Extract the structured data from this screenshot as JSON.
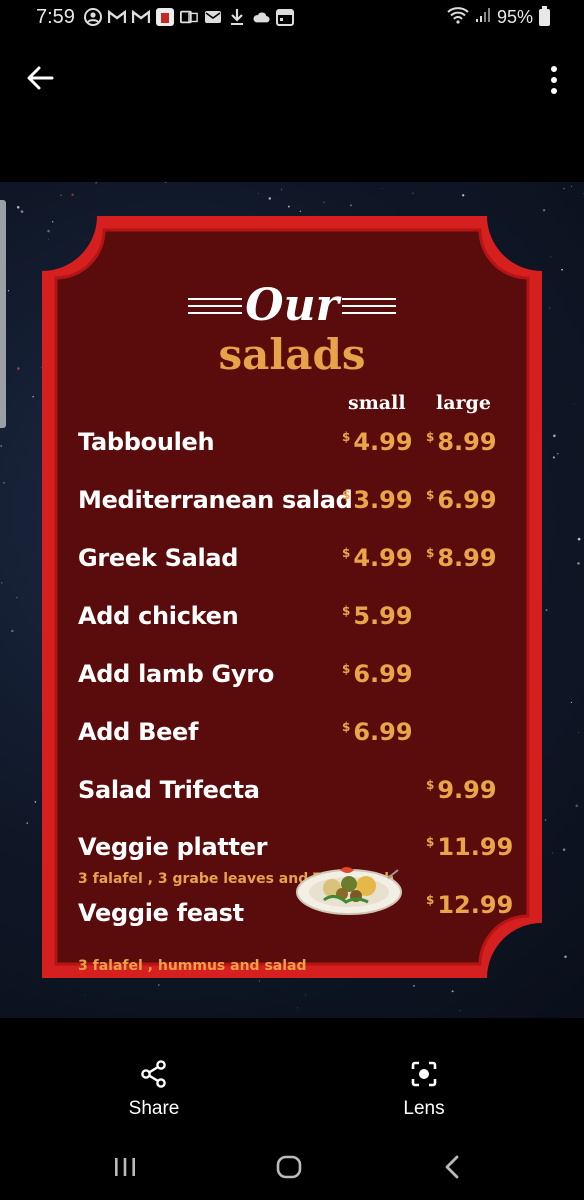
{
  "status_bar": {
    "time": "7:59",
    "battery": "95%",
    "icons": [
      "account-icon",
      "gmail-icon",
      "gmail-icon",
      "app-icon",
      "outlook-icon",
      "email-icon",
      "download-icon",
      "cloud-icon",
      "calendar-icon",
      "wifi-icon",
      "signal-icon",
      "battery-icon"
    ]
  },
  "menu": {
    "title_top": "Our",
    "title_bottom": "salads",
    "col_small": "small",
    "col_large": "large",
    "currency": "$",
    "items": [
      {
        "name": "Tabbouleh",
        "small": "4.99",
        "large": "8.99"
      },
      {
        "name": "Mediterranean salad",
        "small": "3.99",
        "large": "6.99"
      },
      {
        "name": "Greek Salad",
        "small": "4.99",
        "large": "8.99"
      },
      {
        "name": "Add chicken",
        "small": "5.99"
      },
      {
        "name": "Add lamb Gyro",
        "small": "6.99"
      },
      {
        "name": "Add Beef",
        "small": "6.99"
      },
      {
        "name": "Salad Trifecta",
        "large": "9.99"
      },
      {
        "name": "Veggie platter",
        "large": "11.99",
        "desc": "3 falafel , 3 grabe leaves and Tabbouleh"
      },
      {
        "name": "Veggie feast",
        "large": "12.99",
        "desc": "3 falafel , hummus and salad"
      }
    ]
  },
  "actions": {
    "share": "Share",
    "lens": "Lens"
  },
  "colors": {
    "board_red": "#d61f1f",
    "board_maroon": "#5a0c0c",
    "price_orange": "#eaa54b"
  }
}
